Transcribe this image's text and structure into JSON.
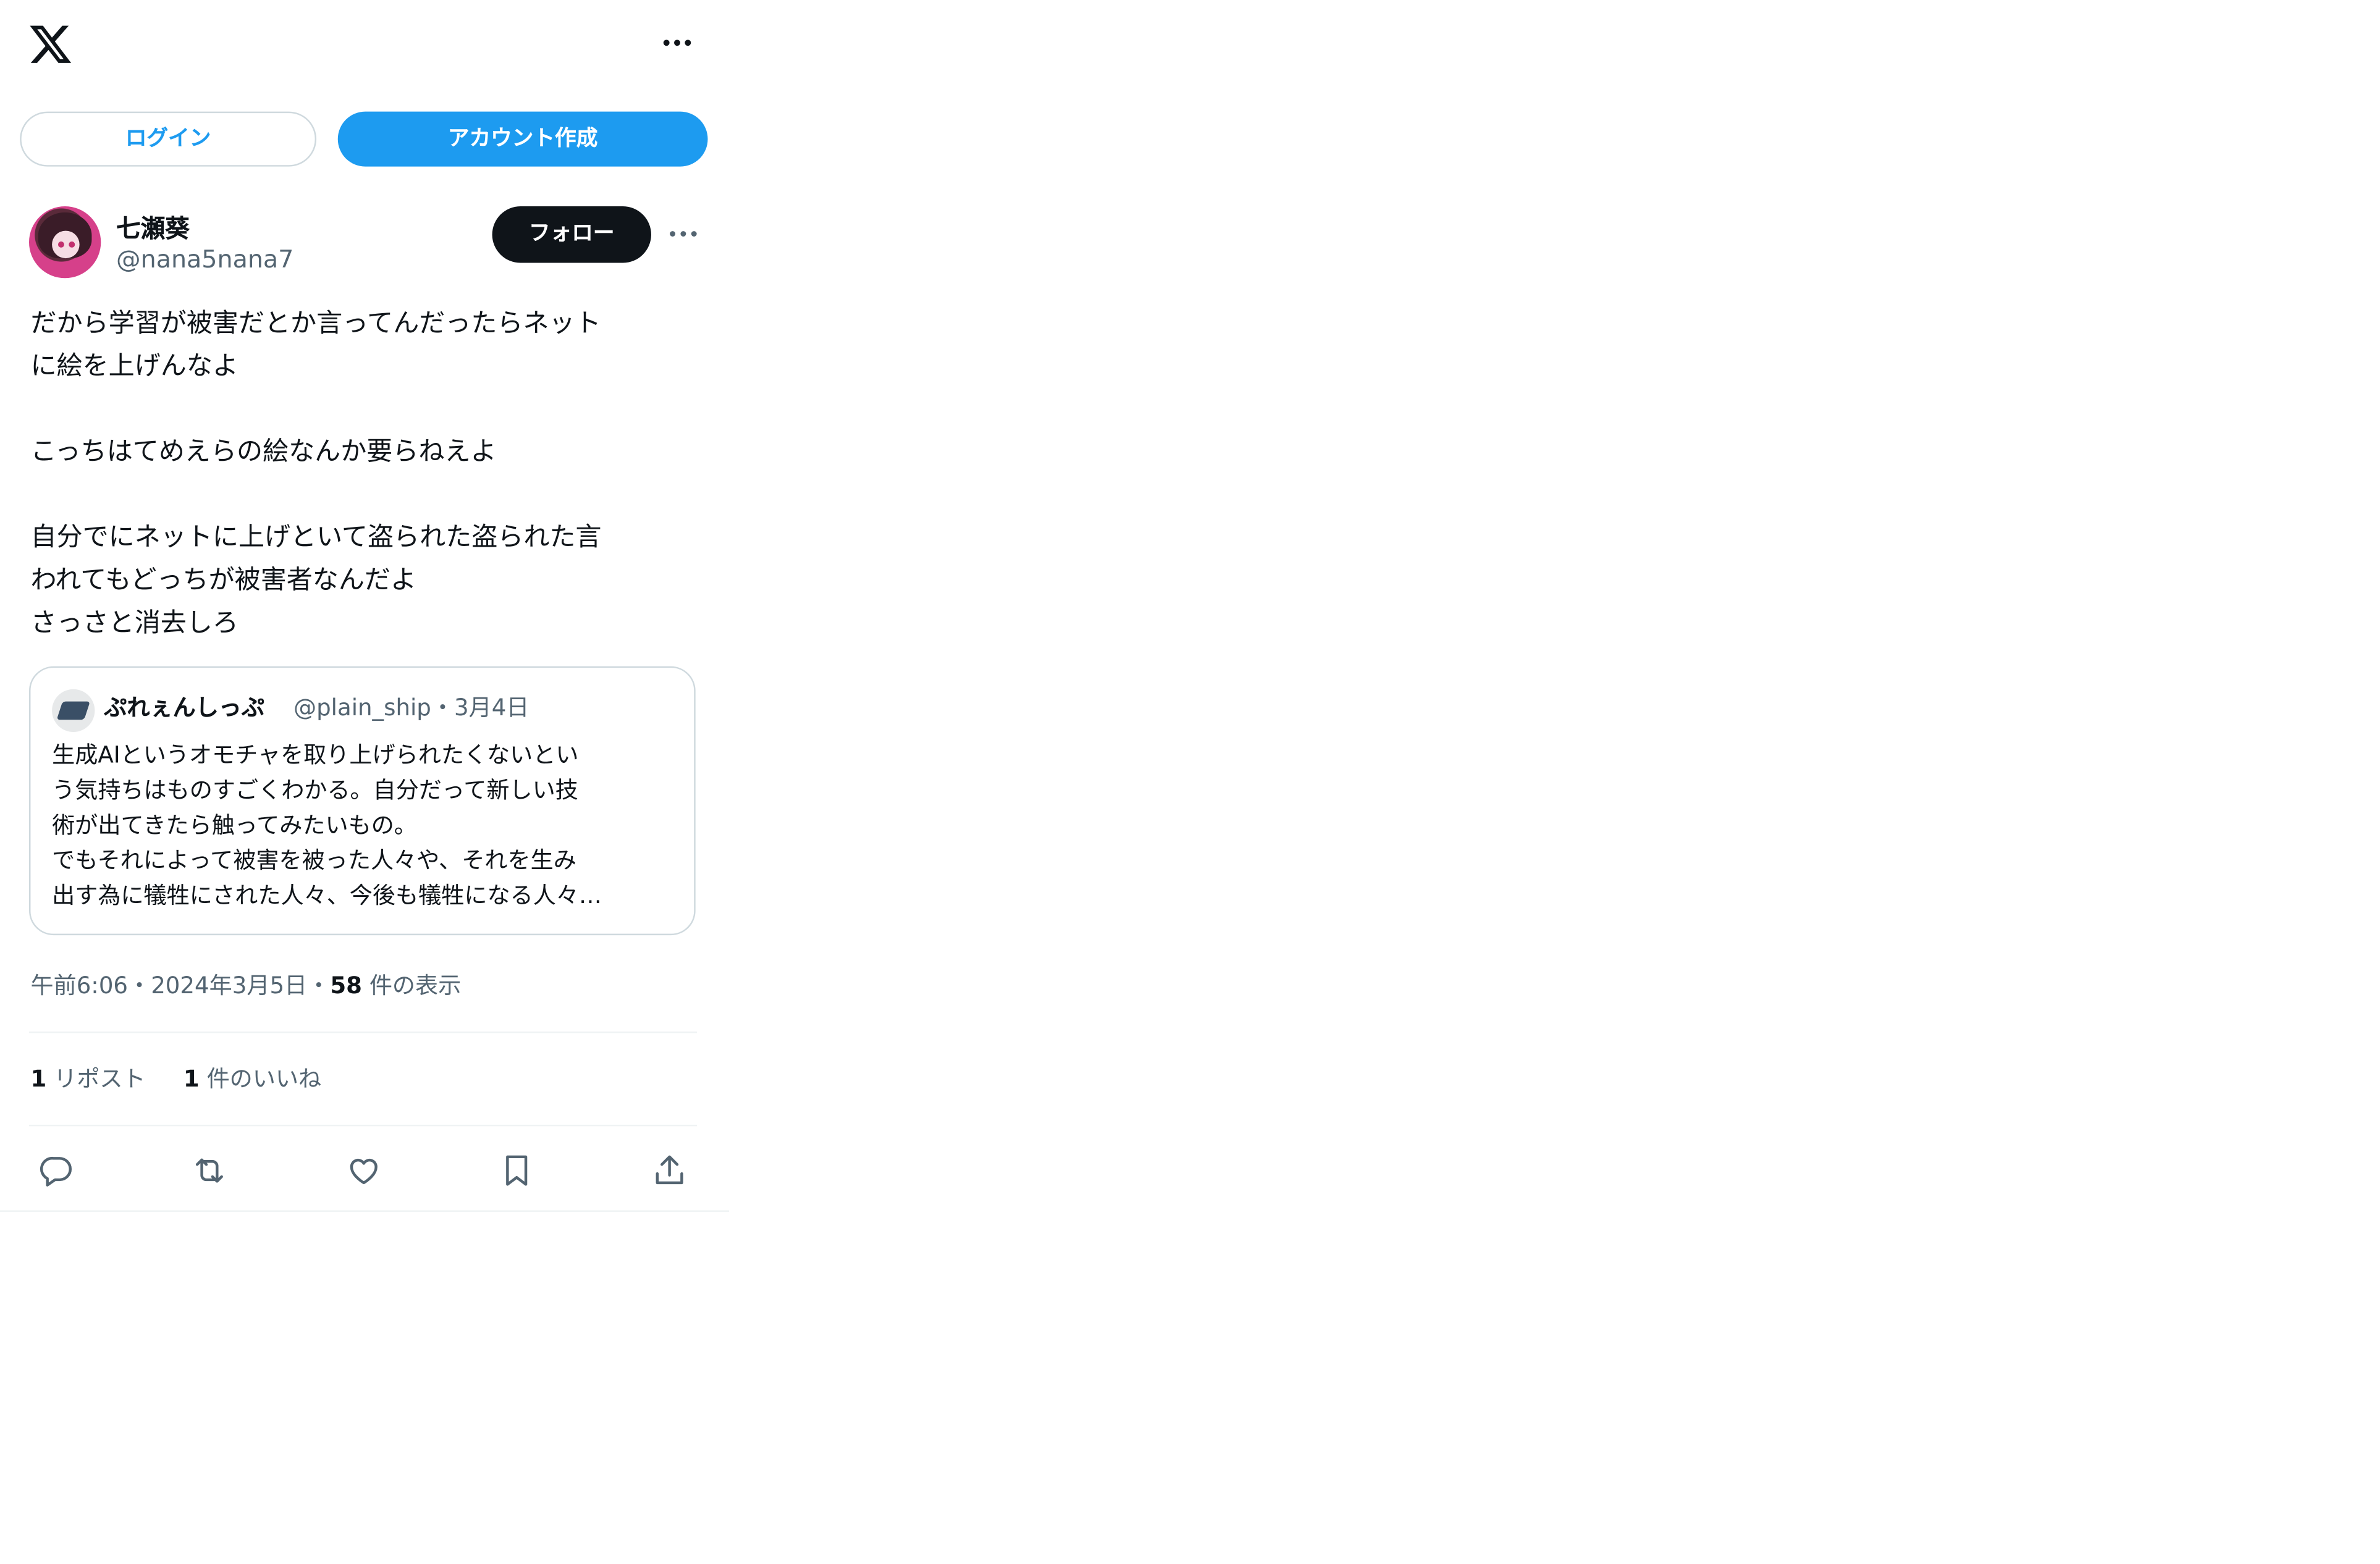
{
  "header": {
    "logo_icon": "x-logo-icon",
    "more_icon": "more-horizontal-icon"
  },
  "auth": {
    "login_label": "ログイン",
    "create_account_label": "アカウント作成"
  },
  "post": {
    "author_name": "七瀬葵",
    "author_handle": "@nana5nana7",
    "follow_label": "フォロー",
    "text": "だから学習が被害だとか言ってんだったらネット\nに絵を上げんなよ\n\nこっちはてめえらの絵なんか要らねえよ\n\n自分でにネットに上げといて盗られた盗られた言\nわれてもどっちが被害者なんだよ\nさっさと消去しろ",
    "quote": {
      "author_name": "ぷれぇんしっぷ",
      "author_handle": "@plain_ship",
      "separator": "・",
      "date": "3月4日",
      "text": "生成AIというオモチャを取り上げられたくないとい\nう気持ちはものすごくわかる。自分だって新しい技\n術が出てきたら触ってみたいもの。\nでもそれによって被害を被った人々や、それを生み\n出す為に犠牲にされた人々、今後も犠牲になる人々…"
    },
    "meta": {
      "time": "午前6:06",
      "sep1": "・",
      "date": "2024年3月5日",
      "sep2": "・",
      "views_count": "58",
      "views_label": "件の表示"
    },
    "stats": {
      "reposts_count": "1",
      "reposts_label": "リポスト",
      "likes_count": "1",
      "likes_label": "件のいいね"
    },
    "actions": [
      "reply-icon",
      "repost-icon",
      "like-icon",
      "bookmark-icon",
      "share-icon"
    ]
  },
  "colors": {
    "accent": "#1d9bf0",
    "text": "#0f1419",
    "secondary": "#536471",
    "border": "#cfd9de"
  }
}
